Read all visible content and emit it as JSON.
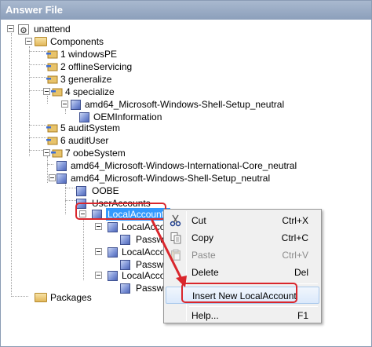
{
  "window": {
    "title": "Answer File"
  },
  "tree": {
    "root": "unattend",
    "components": "Components",
    "passes": [
      "1 windowsPE",
      "2 offlineServicing",
      "3 generalize",
      "4 specialize",
      "5 auditSystem",
      "6 auditUser",
      "7 oobeSystem"
    ],
    "specialize_child": "amd64_Microsoft-Windows-Shell-Setup_neutral",
    "specialize_grandchild": "OEMInformation",
    "oobe_child_1": "amd64_Microsoft-Windows-International-Core_neutral",
    "oobe_child_2": "amd64_Microsoft-Windows-Shell-Setup_neutral",
    "oobe": "OOBE",
    "user_accounts": "UserAccounts",
    "local_accounts": "LocalAccounts",
    "local_account_items": [
      "LocalAccou",
      "LocalAccou",
      "LocalAccou"
    ],
    "password_items": [
      "Passwo",
      "Passw",
      "Passwo"
    ],
    "packages": "Packages"
  },
  "context_menu": {
    "items": [
      {
        "label": "Cut",
        "shortcut": "Ctrl+X",
        "icon": "scissors-icon",
        "disabled": false
      },
      {
        "label": "Copy",
        "shortcut": "Ctrl+C",
        "icon": "copy-icon",
        "disabled": false
      },
      {
        "label": "Paste",
        "shortcut": "Ctrl+V",
        "icon": "paste-icon",
        "disabled": true
      },
      {
        "label": "Delete",
        "shortcut": "Del",
        "icon": "",
        "disabled": false
      },
      {
        "label": "Insert New LocalAccount",
        "shortcut": "",
        "icon": "",
        "disabled": false
      },
      {
        "label": "Help...",
        "shortcut": "F1",
        "icon": "",
        "disabled": false
      }
    ]
  },
  "colors": {
    "annotation": "#d9262c",
    "selection": "#3399ff",
    "title_bar": "#8c9fbb"
  }
}
